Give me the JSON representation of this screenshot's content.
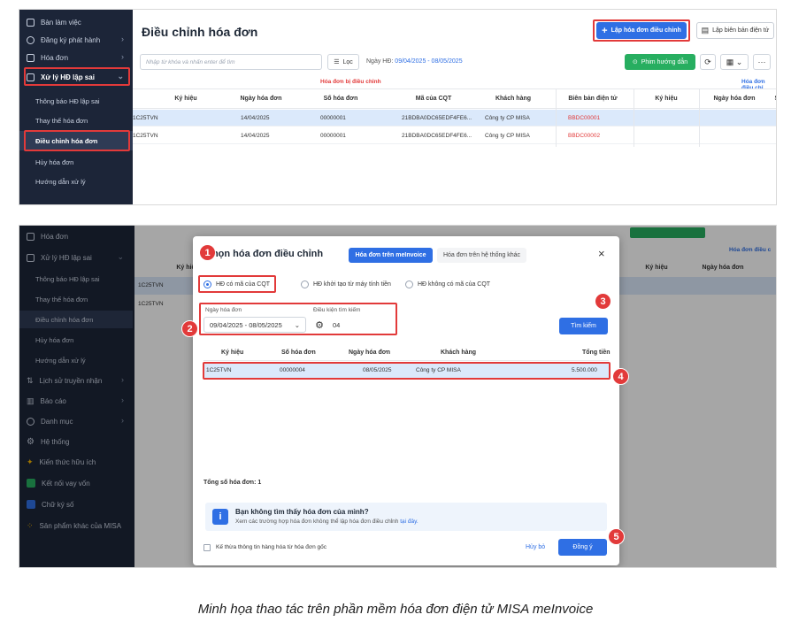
{
  "top": {
    "sidebar": {
      "items": [
        {
          "label": "Bàn làm việc",
          "icon": "monitor-icon",
          "has_chevron": false
        },
        {
          "label": "Đăng ký phát hành",
          "icon": "register-icon",
          "has_chevron": true
        },
        {
          "label": "Hóa đơn",
          "icon": "invoice-icon",
          "has_chevron": true
        },
        {
          "label": "Xử lý HĐ lập sai",
          "icon": "fix-invoice-icon",
          "has_chevron": true
        }
      ],
      "subitems": [
        "Thông báo HĐ lập sai",
        "Thay thế hóa đơn",
        "Điều chỉnh hóa đơn",
        "Hủy hóa đơn",
        "Hướng dẫn xử lý"
      ],
      "active_subitem": "Điều chỉnh hóa đơn"
    },
    "header": {
      "title": "Điều chỉnh hóa đơn",
      "create_adjust_button": "Lập hóa đơn điều chỉnh",
      "create_record_button": "Lập biên bản điện tử"
    },
    "toolbar": {
      "search_placeholder": "Nhập từ khóa và nhấn enter để tìm",
      "filter_label": "Lọc",
      "date_label": "Ngày HĐ:",
      "date_range": "09/04/2025 - 08/05/2025",
      "guide_button": "Phim hướng dẫn"
    },
    "table": {
      "group_adjusted": "Hóa đơn bị điều chỉnh",
      "group_adjusting": "Hóa đơn điều chỉ",
      "columns": [
        "Ký hiệu",
        "Ngày hóa đơn",
        "Số hóa đơn",
        "Mã của CQT",
        "Khách hàng",
        "Biên bản điện tử",
        "Ký hiệu",
        "Ngày hóa đơn",
        "Số"
      ],
      "rows": [
        {
          "kyhieu": "1C25TVN",
          "ngay": "14/04/2025",
          "so": "00000001",
          "macqt": "21BDBA0DC65EDF4FE6...",
          "khach": "Công ty CP MISA",
          "bienban": "BBDC00001"
        },
        {
          "kyhieu": "1C25TVN",
          "ngay": "14/04/2025",
          "so": "00000001",
          "macqt": "21BDBA0DC65EDF4FE6...",
          "khach": "Công ty CP MISA",
          "bienban": "BBDC00002"
        }
      ]
    }
  },
  "bottom": {
    "sidebar": {
      "items_top": [
        "Hóa đơn",
        "Xử lý HĐ lập sai"
      ],
      "subitems": [
        "Thông báo HĐ lập sai",
        "Thay thế hóa đơn",
        "Điều chỉnh hóa đơn",
        "Hủy hóa đơn",
        "Hướng dẫn xử lý"
      ],
      "items_bottom": [
        "Lịch sử truyền nhận",
        "Báo cáo",
        "Danh mục",
        "Hệ thống",
        "Kiến thức hữu ích",
        "Kết nối vay vốn",
        "Chữ ký số",
        "Sản phẩm khác của MISA"
      ]
    },
    "background_table": {
      "col_kyhieu": "Ký hiệu",
      "rows": [
        "1C25TVN",
        "1C25TVN"
      ],
      "col_kyhieu2": "Ký hiệu",
      "col_ngay2": "Ngày hóa đơn",
      "group_adjusting": "Hóa đơn điều c"
    },
    "dialog": {
      "title": "Chọn hóa đơn điều chỉnh",
      "tab_active": "Hóa đơn trên meInvoice",
      "tab_other": "Hóa đơn trên hệ thống khác",
      "radios": [
        "HĐ có mã của CQT",
        "HĐ khởi tạo từ máy tính tiền",
        "HĐ không có mã của CQT"
      ],
      "selected_radio": "HĐ có mã của CQT",
      "date_label": "Ngày hóa đơn",
      "date_value": "09/04/2025 - 08/05/2025",
      "condition_label": "Điều kiện tìm kiếm",
      "condition_value": "04",
      "search_button": "Tìm kiếm",
      "columns": [
        "Ký hiệu",
        "Số hóa đơn",
        "Ngày hóa đơn",
        "Khách hàng",
        "Tổng tiền"
      ],
      "rows": [
        {
          "kyhieu": "1C25TVN",
          "so": "00000004",
          "ngay": "08/05/2025",
          "khach": "Công ty CP MISA",
          "tong": "5.500.000"
        }
      ],
      "total_label": "Tổng số hóa đơn:",
      "total_value": "1",
      "notice_title": "Bạn không tìm thấy hóa đơn của mình?",
      "notice_text": "Xem các trường hợp hóa đơn không thể lập hóa đơn điều chỉnh",
      "notice_link": "tại đây.",
      "inherit_label": "Kế thừa thông tin hàng hóa từ hóa đơn gốc",
      "cancel_button": "Hủy bỏ",
      "agree_button": "Đồng ý"
    },
    "badges": [
      "1",
      "2",
      "3",
      "4",
      "5"
    ]
  },
  "caption": "Minh họa thao tác trên phần mềm hóa đơn điện tử MISA meInvoice",
  "colors": {
    "accent": "#2f6fe4",
    "highlight": "#e23a3a",
    "sidebar": "#1c2538",
    "green": "#27ae60"
  }
}
